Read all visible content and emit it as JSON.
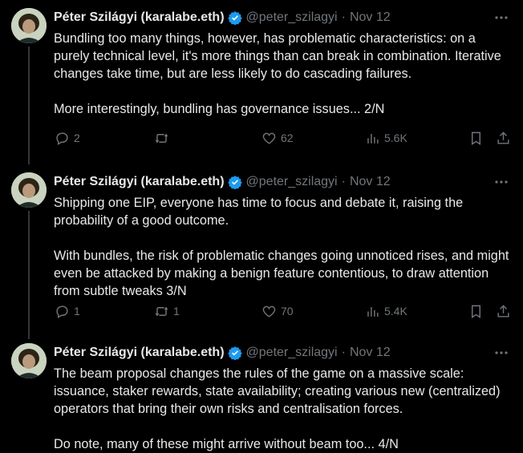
{
  "colors": {
    "background": "#000000",
    "text": "#e7e9ea",
    "muted": "#71767b",
    "verified": "#1d9bf0"
  },
  "tweets": [
    {
      "author": "Péter Szilágyi (karalabe.eth)",
      "handle": "@peter_szilagyi",
      "separator": "·",
      "date": "Nov 12",
      "text": "Bundling too many things, however, has problematic characteristics: on a purely technical level, it's more things than can break in combination. Iterative changes take time, but are less likely to do cascading failures.\n\nMore interestingly, bundling has governance issues... 2/N",
      "replies": "2",
      "reposts": "",
      "likes": "62",
      "views": "5.6K"
    },
    {
      "author": "Péter Szilágyi (karalabe.eth)",
      "handle": "@peter_szilagyi",
      "separator": "·",
      "date": "Nov 12",
      "text": "Shipping one EIP, everyone has time to focus and debate it, raising the probability of a good outcome.\n\nWith bundles, the risk of problematic changes going unnoticed rises, and might even be attacked by making a benign feature contentious, to draw attention from subtle tweaks 3/N",
      "replies": "1",
      "reposts": "1",
      "likes": "70",
      "views": "5.4K"
    },
    {
      "author": "Péter Szilágyi (karalabe.eth)",
      "handle": "@peter_szilagyi",
      "separator": "·",
      "date": "Nov 12",
      "text": "The beam proposal changes the rules of the game on a massive scale: issuance, staker rewards, state availability; creating various new (centralized) operators that bring their own risks and centralisation forces.\n\nDo note, many of these might arrive without beam too... 4/N"
    }
  ]
}
